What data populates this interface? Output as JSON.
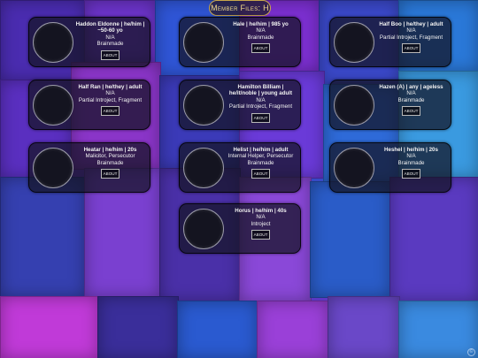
{
  "header": {
    "title": "Member Files: H"
  },
  "about_label": "ABOUT",
  "watermark": "©",
  "colors": {
    "header_border": "#c9a74b",
    "header_text": "#f0d98a",
    "card_bg": "rgba(20,20,35,0.72)",
    "background_primary": "#5a2bb0",
    "background_secondary": "#2b4fc7"
  },
  "members": [
    {
      "name": "Haddon Eldonne | he/him | ~50-60 yo",
      "source": "N/A",
      "role": "Brainmade"
    },
    {
      "name": "Hale | he/him | 985 yo",
      "source": "N/A",
      "role": "Brainmade"
    },
    {
      "name": "Half Boo | he/they | adult",
      "source": "N/A",
      "role": "Partial Introject, Fragment"
    },
    {
      "name": "Half Ran | he/they | adult",
      "source": "N/A",
      "role": "Partial Introject, Fragment"
    },
    {
      "name": "Hamilton Billiam | he/it/noble | young adult",
      "source": "N/A",
      "role": "Partial Introject, Fragment"
    },
    {
      "name": "Hazen (A) | any | ageless",
      "source": "N/A",
      "role": "Brainmade"
    },
    {
      "name": "Heatar | he/him | 20s",
      "source": "Malicitor, Persecutor",
      "role": "Brainmade"
    },
    {
      "name": "Helist | he/him | adult",
      "source": "Internal Helper, Persecutor",
      "role": "Brainmade"
    },
    {
      "name": "Heshel | he/him | 20s",
      "source": "N/A",
      "role": "Brainmade"
    },
    {
      "name": "Horus | he/him | 40s",
      "source": "N/A",
      "role": "Introject"
    }
  ]
}
